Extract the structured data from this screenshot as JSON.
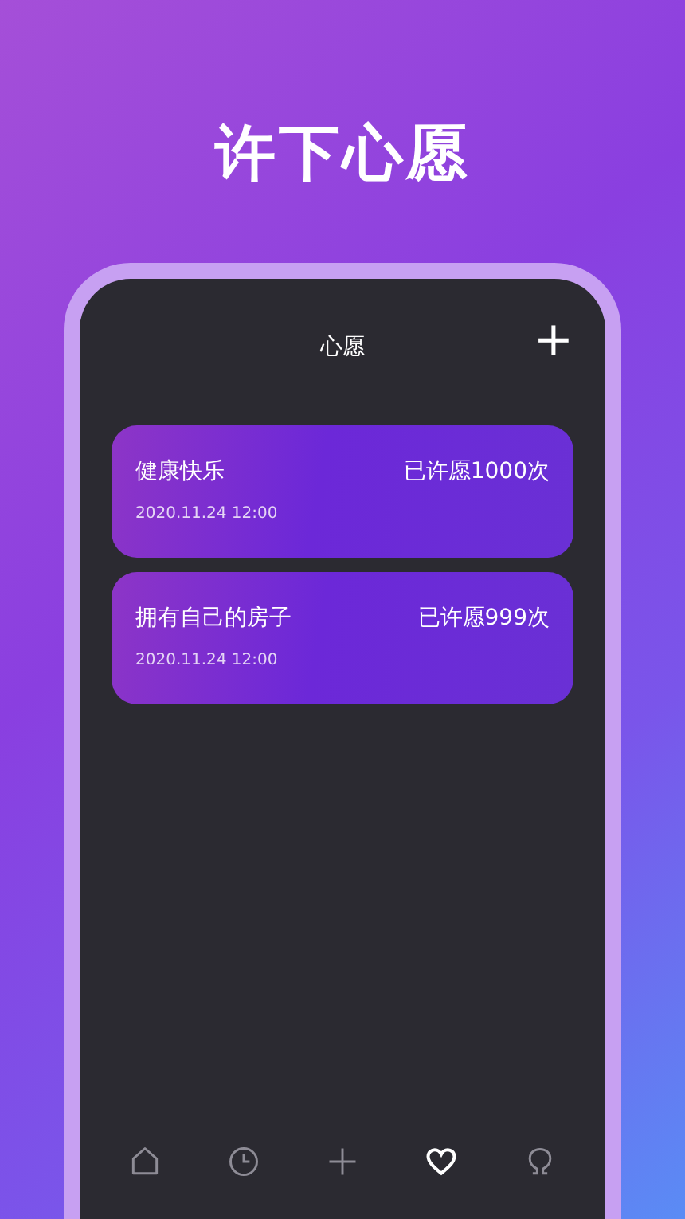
{
  "headline": "许下心愿",
  "screen": {
    "title": "心愿",
    "add_icon": "+"
  },
  "wishes": [
    {
      "name": "健康快乐",
      "count": "已许愿1000次",
      "date": "2020.11.24 12:00"
    },
    {
      "name": "拥有自己的房子",
      "count": "已许愿999次",
      "date": "2020.11.24 12:00"
    }
  ],
  "tab_bar": [
    {
      "kind": "home",
      "selected": false
    },
    {
      "kind": "clock",
      "selected": false
    },
    {
      "kind": "plus",
      "selected": false
    },
    {
      "kind": "heart",
      "selected": true
    },
    {
      "kind": "person",
      "selected": false
    }
  ]
}
